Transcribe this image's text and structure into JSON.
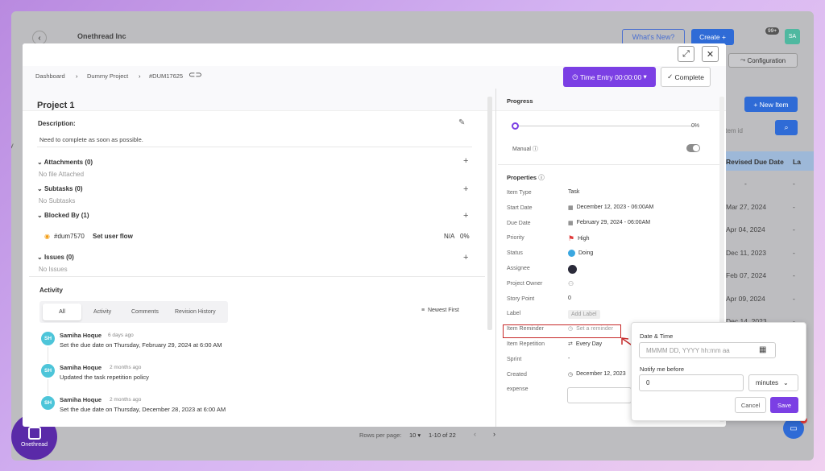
{
  "background": {
    "company": "Onethread Inc",
    "whats_new": "What's New?",
    "create": "Create +",
    "notif_count": "99+",
    "user_initials": "SA",
    "configuration": "Configuration",
    "new_item": "New Item",
    "search_placeholder": "Item id",
    "column_header": "Revised Due Date",
    "column_header2": "La",
    "dates": [
      "-",
      "Mar 27, 2024",
      "Apr 04, 2024",
      "Dec 11, 2023",
      "Feb 07, 2024",
      "Apr 09, 2024",
      "Dec 14, 2023"
    ],
    "dashes": [
      "-",
      "-",
      "-",
      "-",
      "-",
      "-",
      "-"
    ],
    "left_letter": "ry",
    "rows_per_page": "Rows per page:",
    "rows_value": "10",
    "range": "1-10 of 22",
    "brand": "Onethread",
    "chat_badge": "1"
  },
  "header": {
    "breadcrumb": [
      "Dashboard",
      "Dummy Project",
      "#DUM17625"
    ],
    "time_entry": "Time Entry 00:00:00",
    "complete": "Complete"
  },
  "left": {
    "title": "Project 1",
    "description_label": "Description:",
    "description": "Need to complete as soon as possible.",
    "attachments": "Attachments (0)",
    "no_file": "No file Attached",
    "subtasks": "Subtasks (0)",
    "no_subtasks": "No Subtasks",
    "blocked_by": "Blocked By (1)",
    "blocked_id": "#dum7570",
    "blocked_name": "Set user flow",
    "blocked_na": "N/A",
    "blocked_pct": "0%",
    "issues": "Issues (0)",
    "no_issues": "No Issues",
    "activity": "Activity",
    "tabs": [
      "All",
      "Activity",
      "Comments",
      "Revision History"
    ],
    "sort": "Newest First",
    "entries": [
      {
        "initials": "SH",
        "name": "Samiha Hoque",
        "time": "6 days ago",
        "text": "Set the due date on Thursday, February 29, 2024 at 6:00 AM"
      },
      {
        "initials": "SH",
        "name": "Samiha Hoque",
        "time": "2 months ago",
        "text": "Updated the task repetition policy"
      },
      {
        "initials": "SH",
        "name": "Samiha Hoque",
        "time": "2 months ago",
        "text": "Set the due date on Thursday, December 28, 2023 at 6:00 AM"
      }
    ]
  },
  "right": {
    "progress_label": "Progress",
    "progress_value": 0,
    "progress_text": "0%",
    "manual": "Manual",
    "properties": "Properties",
    "rows": [
      {
        "label": "Item Type",
        "value": "Task"
      },
      {
        "label": "Start Date",
        "value": "December 12, 2023 - 06:00AM"
      },
      {
        "label": "Due Date",
        "value": "February 29, 2024 - 06:00AM"
      },
      {
        "label": "Priority",
        "value": "High"
      },
      {
        "label": "Status",
        "value": "Doing"
      },
      {
        "label": "Assignee",
        "value": ""
      },
      {
        "label": "Project Owner",
        "value": ""
      },
      {
        "label": "Story Point",
        "value": "0"
      },
      {
        "label": "Label",
        "value": "Add Label"
      },
      {
        "label": "Item Reminder",
        "value": "Set a reminder"
      },
      {
        "label": "Item Repetition",
        "value": "Every Day"
      },
      {
        "label": "Sprint",
        "value": "-"
      },
      {
        "label": "Created",
        "value": "December 12, 2023"
      },
      {
        "label": "expense",
        "value": ""
      }
    ],
    "colors": {
      "accent": "#7b3fe4",
      "status": "#3ba7e0",
      "priority": "#e03b3b",
      "reminder_border": "#c62828"
    }
  },
  "popup": {
    "datetime_label": "Date & Time",
    "datetime_placeholder": "MMMM DD, YYYY hh:mm aa",
    "notify_label": "Notify me before",
    "notify_value": "0",
    "unit": "minutes",
    "cancel": "Cancel",
    "save": "Save"
  }
}
